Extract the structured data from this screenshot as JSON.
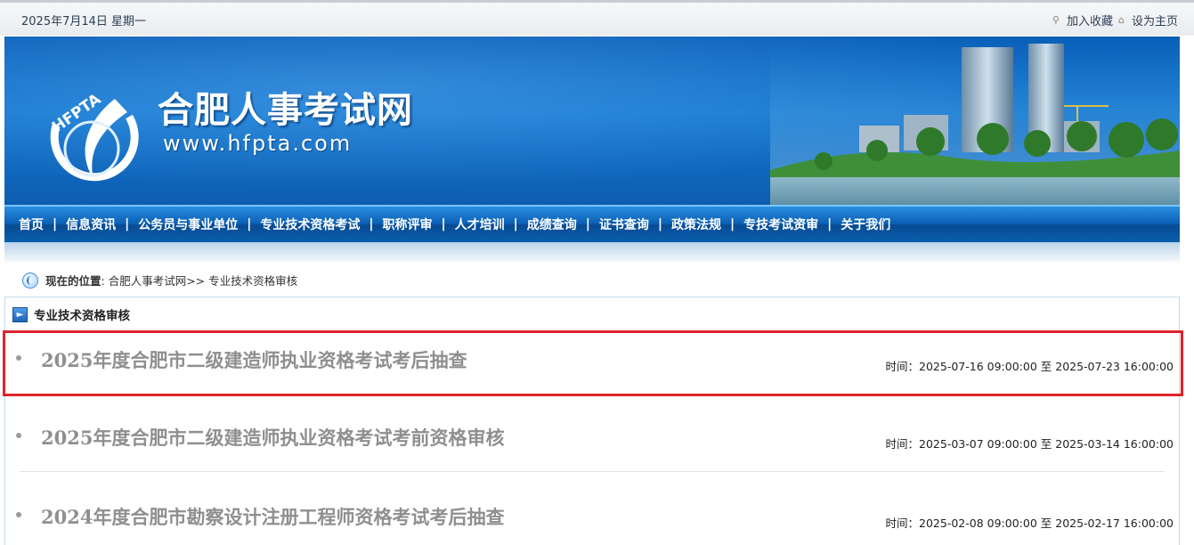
{
  "topbar": {
    "date": "2025年7月14日 星期一",
    "bookmark_label": "加入收藏",
    "homepage_label": "设为主页"
  },
  "banner": {
    "logo_text": "HFPTA",
    "site_name": "合肥人事考试网",
    "site_url": "www.hfpta.com"
  },
  "nav": {
    "items": [
      "首页",
      "信息资讯",
      "公务员与事业单位",
      "专业技术资格考试",
      "职称评审",
      "人才培训",
      "成绩查询",
      "证书查询",
      "政策法规",
      "专技考试资审",
      "关于我们"
    ]
  },
  "location": {
    "label": "现在的位置",
    "path": ": 合肥人事考试网>> 专业技术资格审核"
  },
  "section": {
    "title": "专业技术资格审核"
  },
  "list": [
    {
      "title": "2025年度合肥市二级建造师执业资格考试考后抽查",
      "time": "时间：2025-07-16 09:00:00 至 2025-07-23 16:00:00"
    },
    {
      "title": "2025年度合肥市二级建造师执业资格考试考前资格审核",
      "time": "时间：2025-03-07 09:00:00 至 2025-03-14 16:00:00"
    },
    {
      "title": "2024年度合肥市勘察设计注册工程师资格考试考后抽查",
      "time": "时间：2025-02-08 09:00:00 至 2025-02-17 16:00:00"
    }
  ],
  "colors": {
    "nav_blue": "#0b5fb4",
    "highlight_red": "#e0232b",
    "title_gray": "#8f8f8f"
  }
}
